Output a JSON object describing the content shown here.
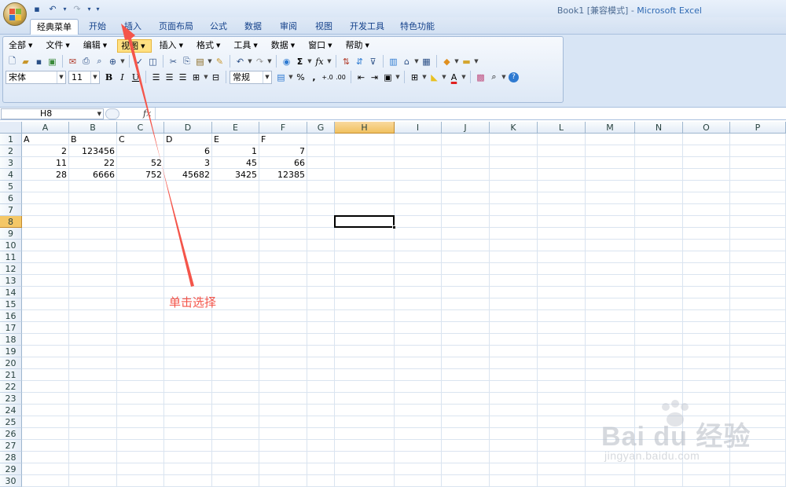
{
  "window": {
    "title_doc": "Book1  [兼容模式] - ",
    "title_app": "Microsoft Excel"
  },
  "quick_access": [
    {
      "icon": "save-icon",
      "glyph": "▪"
    },
    {
      "icon": "undo-icon",
      "glyph": "↶"
    },
    {
      "icon": "undo-dropdown-icon",
      "glyph": "▾"
    },
    {
      "icon": "redo-icon",
      "glyph": "↷"
    },
    {
      "icon": "redo-dropdown-icon",
      "glyph": "▾"
    },
    {
      "icon": "customize-qat-icon",
      "glyph": "▾"
    }
  ],
  "ribbon_tabs": [
    {
      "label": "经典菜单",
      "active": true
    },
    {
      "label": "开始",
      "active": false
    },
    {
      "label": "插入",
      "active": false
    },
    {
      "label": "页面布局",
      "active": false
    },
    {
      "label": "公式",
      "active": false
    },
    {
      "label": "数据",
      "active": false
    },
    {
      "label": "审阅",
      "active": false
    },
    {
      "label": "视图",
      "active": false
    },
    {
      "label": "开发工具",
      "active": false
    },
    {
      "label": "特色功能",
      "active": false
    }
  ],
  "classic_menus": [
    {
      "label": "全部",
      "highlight": false
    },
    {
      "label": "文件",
      "highlight": false
    },
    {
      "label": "编辑",
      "highlight": false
    },
    {
      "label": "视图",
      "highlight": true
    },
    {
      "label": "插入",
      "highlight": false
    },
    {
      "label": "格式",
      "highlight": false
    },
    {
      "label": "工具",
      "highlight": false
    },
    {
      "label": "数据",
      "highlight": false
    },
    {
      "label": "窗口",
      "highlight": false
    },
    {
      "label": "帮助",
      "highlight": false
    }
  ],
  "toolbar": {
    "font_name": "宋体",
    "font_size": "11",
    "bold": "B",
    "italic": "I",
    "underline": "U",
    "number_format": "常规",
    "percent": "%",
    "comma": ",",
    "sum_glyph": "Σ",
    "fx_glyph": "fx"
  },
  "formula_bar": {
    "name_box": "H8",
    "fx_label": "fx",
    "formula": ""
  },
  "sheet": {
    "columns": [
      "A",
      "B",
      "C",
      "D",
      "E",
      "F",
      "G",
      "H",
      "I",
      "J",
      "K",
      "L",
      "M",
      "N",
      "O",
      "P"
    ],
    "selected_column": "H",
    "rows": [
      "1",
      "2",
      "3",
      "4",
      "5",
      "6",
      "7",
      "8",
      "9",
      "10",
      "11",
      "12",
      "13",
      "14",
      "15",
      "16",
      "17",
      "18",
      "19",
      "20",
      "21",
      "22",
      "23",
      "24",
      "25",
      "26",
      "27",
      "28",
      "29",
      "30"
    ],
    "selected_row": "8",
    "active_cell": "H8",
    "data": [
      [
        "A",
        "B",
        "C",
        "D",
        "E",
        "F"
      ],
      [
        2,
        123456,
        null,
        6,
        1,
        7
      ],
      [
        11,
        22,
        52,
        3,
        45,
        66
      ],
      [
        28,
        6666,
        752,
        45682,
        3425,
        12385
      ]
    ]
  },
  "annotation": {
    "text": "单击选择",
    "color": "#f4554a"
  },
  "watermark": {
    "brand": "Bai du 经验",
    "url": "jingyan.baidu.com"
  },
  "colors": {
    "accent": "#15428b",
    "selected_header": "#f1c15f",
    "annotation": "#f4554a"
  }
}
